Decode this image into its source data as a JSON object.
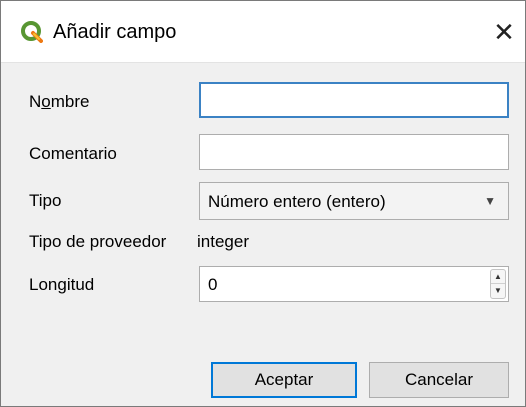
{
  "window": {
    "title": "Añadir campo",
    "icon": "qgis-logo-icon",
    "close_symbol": "✕"
  },
  "colors": {
    "focus_border": "#3b82c4",
    "primary_button_border": "#0078d7",
    "dialog_background": "#f0f0f0"
  },
  "form": {
    "name": {
      "label_before_mnemonic": "N",
      "label_mnemonic": "o",
      "label_after_mnemonic": "mbre",
      "value": ""
    },
    "comment": {
      "label": "Comentario",
      "value": ""
    },
    "type": {
      "label": "Tipo",
      "selected": "Número entero (entero)",
      "arrow": "▼"
    },
    "provider_type": {
      "label": "Tipo de proveedor",
      "value": "integer"
    },
    "length": {
      "label": "Longitud",
      "value": "0",
      "up_symbol": "▲",
      "down_symbol": "▼"
    }
  },
  "buttons": {
    "accept": "Aceptar",
    "cancel": "Cancelar"
  }
}
